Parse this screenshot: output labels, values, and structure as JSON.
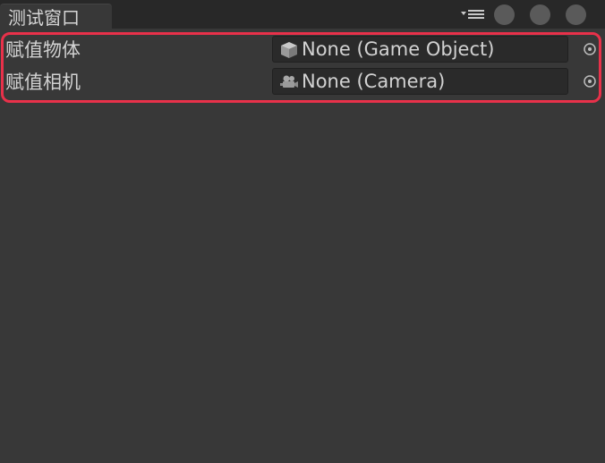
{
  "window": {
    "tab_title": "测试窗口",
    "icons": {
      "menu": "tab-menu-icon",
      "buttons": [
        "window-button-icon",
        "window-button-icon",
        "window-button-icon"
      ]
    }
  },
  "fields": [
    {
      "label": "赋值物体",
      "value": "None (Game Object)",
      "icon": "gameobject-cube-icon"
    },
    {
      "label": "赋值相机",
      "value": "None (Camera)",
      "icon": "camera-icon"
    }
  ],
  "colors": {
    "background": "#383838",
    "titlebar": "#282828",
    "field_background": "#2a2a2a",
    "text": "#d2d2d2",
    "highlight": "#e8314a"
  }
}
